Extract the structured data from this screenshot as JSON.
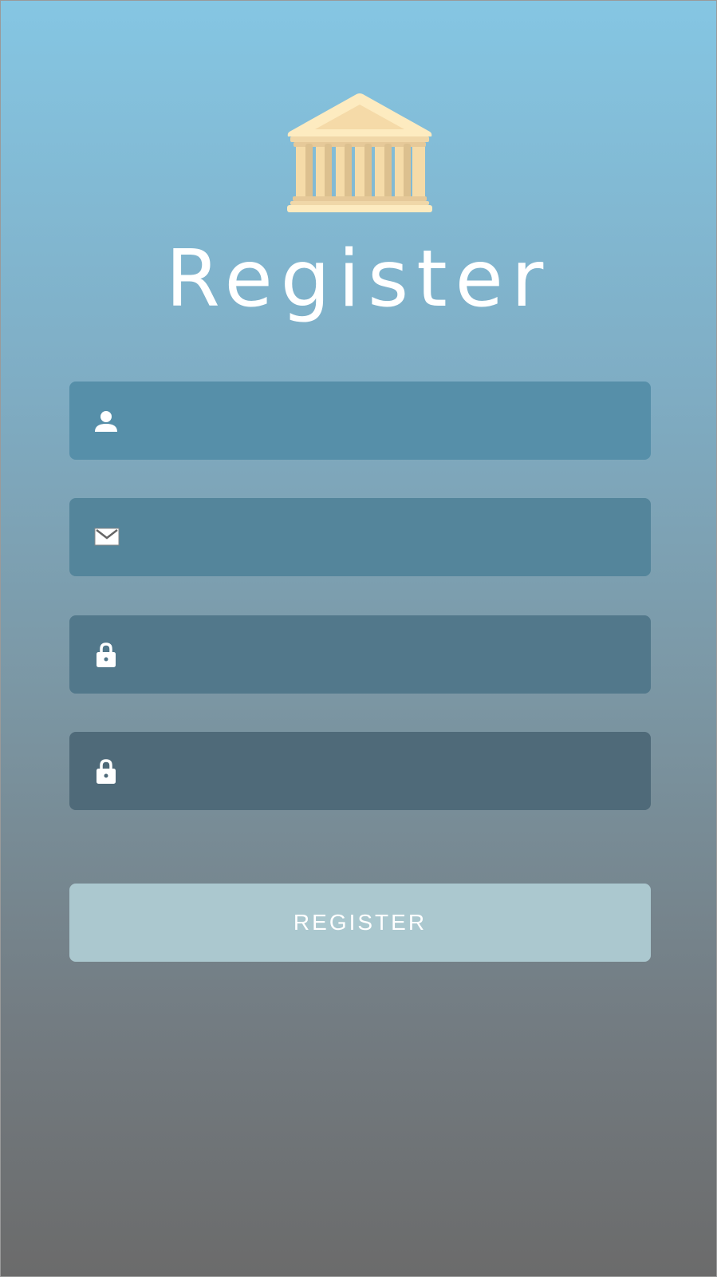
{
  "title": "Register",
  "form": {
    "username": {
      "icon": "user-icon",
      "placeholder": "",
      "value": ""
    },
    "email": {
      "icon": "envelope-icon",
      "placeholder": "",
      "value": ""
    },
    "password": {
      "icon": "lock-icon",
      "placeholder": "",
      "value": ""
    },
    "confirm_password": {
      "icon": "lock-icon",
      "placeholder": "",
      "value": ""
    }
  },
  "register_button": {
    "label": "REGISTER"
  },
  "logo": {
    "icon": "bank-building-icon"
  },
  "colors": {
    "gradient_top": "#85c6e3",
    "gradient_bottom": "#6b6b6b",
    "logo_cream": "#fdebc0",
    "logo_tan": "#dcc08f",
    "button": "#abc8cf"
  }
}
